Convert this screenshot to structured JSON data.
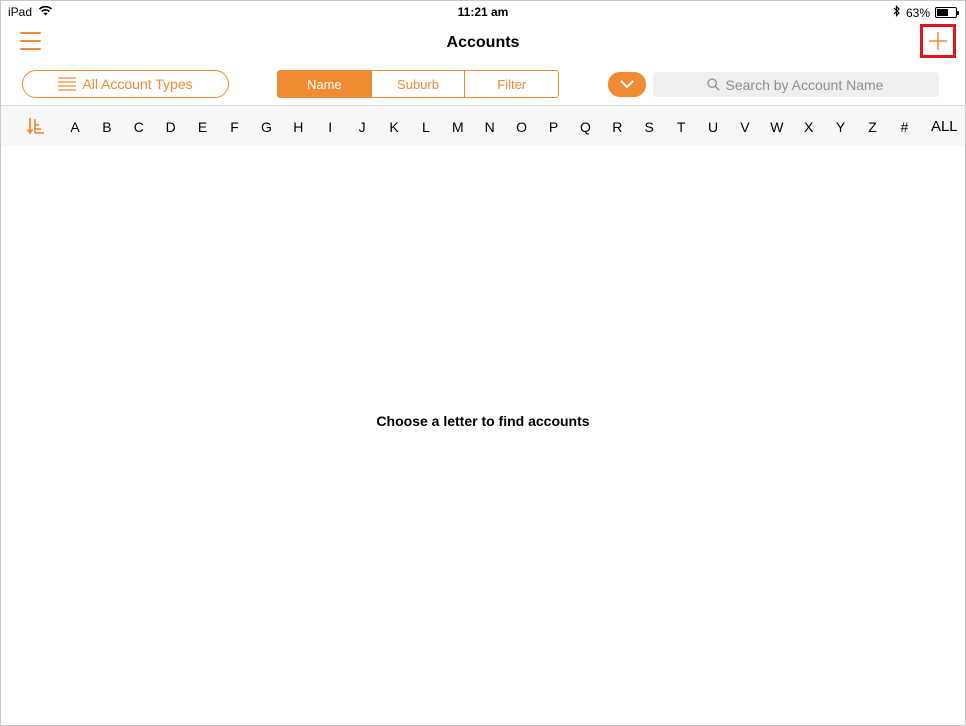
{
  "status_bar": {
    "device": "iPad",
    "time": "11:21 am",
    "battery_percent": "63%",
    "battery_level": 0.63,
    "icons": [
      "wifi-icon",
      "bluetooth-icon",
      "battery-icon"
    ]
  },
  "nav": {
    "title": "Accounts",
    "menu_icon": "hamburger-menu-icon",
    "add_icon": "plus-icon"
  },
  "toolbar": {
    "account_types_label": "All Account Types",
    "segments": [
      {
        "label": "Name",
        "active": true
      },
      {
        "label": "Suburb",
        "active": false
      },
      {
        "label": "Filter",
        "active": false
      }
    ],
    "dropdown_icon": "chevron-down-icon",
    "search_placeholder": "Search by Account Name"
  },
  "alphabet": [
    "A",
    "B",
    "C",
    "D",
    "E",
    "F",
    "G",
    "H",
    "I",
    "J",
    "K",
    "L",
    "M",
    "N",
    "O",
    "P",
    "Q",
    "R",
    "S",
    "T",
    "U",
    "V",
    "W",
    "X",
    "Y",
    "Z",
    "#",
    "ALL"
  ],
  "empty_message": "Choose a letter to find accounts",
  "colors": {
    "accent": "#f08a33",
    "highlight_border": "#e0151e",
    "search_bg": "#efefef",
    "alpha_bar_bg": "#f7f7f7"
  }
}
